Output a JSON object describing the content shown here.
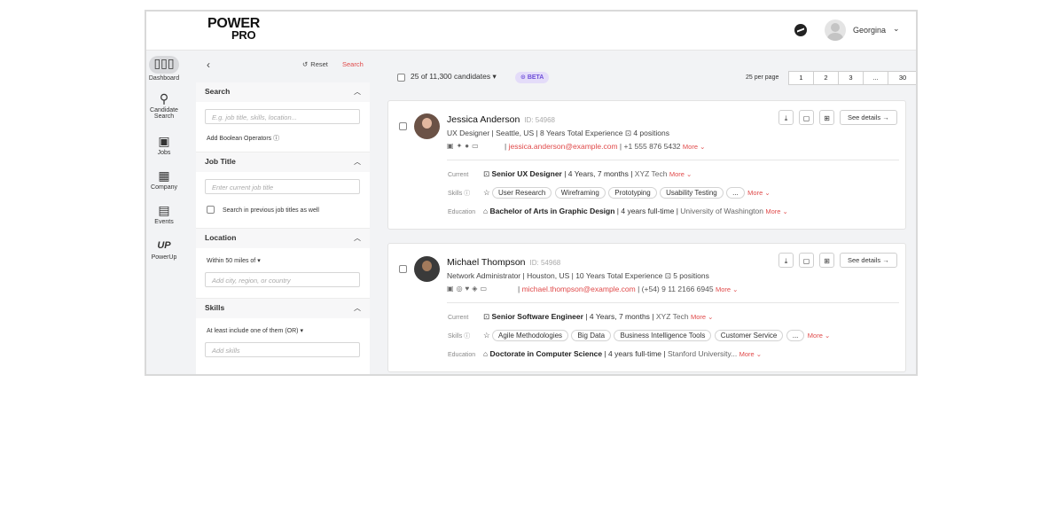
{
  "app": {
    "logo_line1": "POWER",
    "logo_line2": "PRO",
    "user_name": "Georgina"
  },
  "nav": [
    {
      "label": "Dashboard",
      "icon": "bar-chart-icon"
    },
    {
      "label": "Candidate Search",
      "icon": "search-icon"
    },
    {
      "label": "Jobs",
      "icon": "briefcase-icon"
    },
    {
      "label": "Company",
      "icon": "building-icon"
    },
    {
      "label": "Events",
      "icon": "calendar-icon"
    },
    {
      "label": "PowerUp",
      "icon": "powerup-icon"
    }
  ],
  "filters": {
    "reset_label": "Reset",
    "search_label": "Search",
    "search": {
      "title": "Search",
      "placeholder": "E.g. job title, skills, location...",
      "boolean_label": "Add Boolean Operators"
    },
    "job_title": {
      "title": "Job Title",
      "placeholder": "Enter current job title",
      "checkbox_label": "Search in previous job titles as well"
    },
    "location": {
      "title": "Location",
      "radius_label": "Within 50 miles of",
      "placeholder": "Add city, region, or country"
    },
    "skills": {
      "title": "Skills",
      "mode_label": "At least include one of them (OR)",
      "placeholder": "Add skills"
    }
  },
  "results": {
    "count_label": "25 of 11,300 candidates",
    "beta_label": "BETA",
    "per_page_label": "25 per page",
    "pages": [
      "1",
      "2",
      "3",
      "...",
      "30"
    ]
  },
  "candidates": [
    {
      "name": "Jessica Anderson",
      "id": "ID: 54968",
      "meta": "UX Designer  |  Seattle, US  |  8 Years Total Experience",
      "positions": "4 positions",
      "email": "jessica.anderson@example.com",
      "phone": "+1 555 876 5432",
      "more": "More",
      "current_label": "Current",
      "current_title": "Senior UX Designer",
      "current_duration": "4 Years,  7 months",
      "current_company": "XYZ Tech",
      "skills_label": "Skills",
      "skills": [
        "User Research",
        "Wireframing",
        "Prototyping",
        "Usability Testing",
        "..."
      ],
      "education_label": "Education",
      "degree": "Bachelor of Arts in Graphic Design",
      "edu_duration": "4 years full-time",
      "school": "University of Washington",
      "see_details": "See details"
    },
    {
      "name": "Michael Thompson",
      "id": "ID: 54968",
      "meta": "Network Administrator  |  Houston, US  |  10 Years Total Experience",
      "positions": "5 positions",
      "email": "michael.thompson@example.com",
      "phone": "(+54) 9 11 2166 6945",
      "more": "More",
      "current_label": "Current",
      "current_title": "Senior Software Engineer",
      "current_duration": "4 Years,  7 months",
      "current_company": "XYZ Tech",
      "skills_label": "Skills",
      "skills": [
        "Agile Methodologies",
        "Big Data",
        "Business Intelligence Tools",
        "Customer Service",
        "..."
      ],
      "education_label": "Education",
      "degree": "Doctorate in Computer Science",
      "edu_duration": "4 years full-time",
      "school": "Stanford University...",
      "see_details": "See details"
    }
  ]
}
